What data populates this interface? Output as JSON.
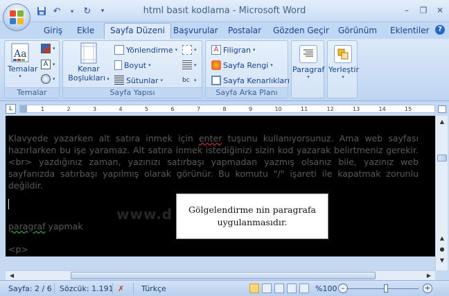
{
  "window": {
    "title": "html basıt kodlama - Microsoft Word"
  },
  "tabs": [
    {
      "label": "Giriş"
    },
    {
      "label": "Ekle"
    },
    {
      "label": "Sayfa Düzeni"
    },
    {
      "label": "Başvurular"
    },
    {
      "label": "Postalar"
    },
    {
      "label": "Gözden Geçir"
    },
    {
      "label": "Görünüm"
    },
    {
      "label": "Eklentiler"
    }
  ],
  "ribbon": {
    "temalar": {
      "button": "Temalar",
      "group": "Temalar"
    },
    "sayfa_yapisi": {
      "kenar_1": "Kenar",
      "kenar_2": "Boşlukları",
      "yonlendirme": "Yönlendirme",
      "boyut": "Boyut",
      "sutunlar": "Sütunlar",
      "group": "Sayfa Yapısı"
    },
    "arka_plan": {
      "filigran": "Filigran",
      "sayfa_rengi": "Sayfa Rengi",
      "kenarliklar": "Sayfa Kenarlıkları",
      "group": "Sayfa Arka Planı"
    },
    "paragraf": "Paragraf",
    "yerlestir": "Yerleştir"
  },
  "ruler": {
    "numbers": [
      "1",
      "2",
      "3",
      "4",
      "5",
      "6",
      "7",
      "8",
      "9",
      "10",
      "11",
      "12",
      "13",
      "14",
      "15"
    ]
  },
  "document": {
    "para_1": "Klavyede yazarken alt satıra inmek için",
    "para_word": "enter",
    "para_2": "tuşunu kullanıyorsunuz. Ama web sayfası hazırlarken bu işe yaramaz. Alt satıra inmek istediğinizi sizin kod yazarak belirtmeniz gerekir. <br> yazdığınız zaman, yazınızı satırbaşı yapmadan yazmış olsanız bile, yazınız web sayfanızda satırbaşı yapılmış olarak görünür. Bu komutu \"/\" işareti ile kapatmak zorunlu değildir.",
    "watermark": "www.d",
    "line2_word": "paragraf",
    "line2_rest": " yapmak",
    "line3": "<p>"
  },
  "callout": {
    "line1": "Gölgelendirme nin paragrafa",
    "line2": "uygulanmasıdır."
  },
  "status": {
    "page": "Sayfa: 2 / 6",
    "words": "Sözcük: 1.191",
    "language": "Türkçe",
    "zoom": "%100"
  }
}
